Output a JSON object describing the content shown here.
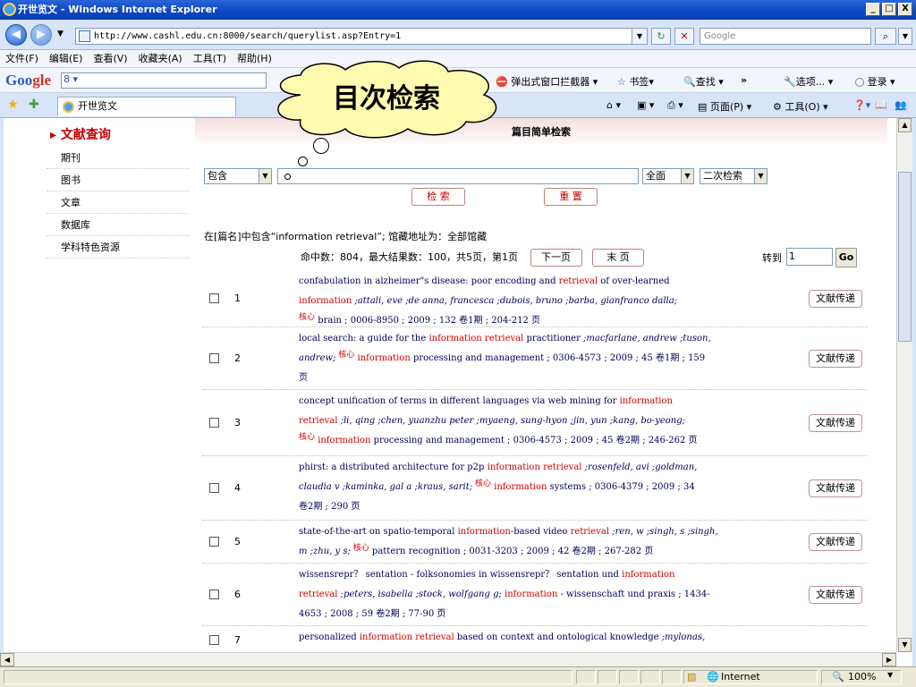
{
  "window": {
    "title": "开世览文 - Windows Internet Explorer"
  },
  "address": {
    "url": "http://www.cashl.edu.cn:8000/search/querylist.asp?Entry=1",
    "search_placeholder": "Google"
  },
  "menu": [
    "文件(F)",
    "编辑(E)",
    "查看(V)",
    "收藏夹(A)",
    "工具(T)",
    "帮助(H)"
  ],
  "gtoolbar": {
    "logo_g": "Goo",
    "logo_o": "gle",
    "popup_blocker": "弹出式窗口拦截器",
    "bookmarks": "书签",
    "find": "查找",
    "more": "»",
    "options": "选项...",
    "login": "登录"
  },
  "tab": {
    "label": "开世览文",
    "page_menu": "页面(P)",
    "tools_menu": "工具(O)"
  },
  "callout": {
    "text": "目次检索"
  },
  "sidebar": {
    "head": "文献查询",
    "items": [
      "期刊",
      "图书",
      "文章",
      "数据库",
      "学科特色资源"
    ]
  },
  "page": {
    "header": "篇目简单检索"
  },
  "form": {
    "match_mode": "包含",
    "query": "",
    "scope": "全面",
    "secondary": "二次检索",
    "search_btn": "检 索",
    "reset_btn": "重 置"
  },
  "meta": {
    "line1": "在[篇名]中包含“information retrieval”;  馆藏地址为：全部馆藏",
    "line2": "命中数：804，最大结果数：100，共5页，第1页",
    "next": "下一页",
    "last": "末 页",
    "goto_label": "转到",
    "goto_value": "1",
    "go": "Go"
  },
  "results": [
    {
      "num": "1",
      "lines": [
        [
          {
            "t": "confabulation in alzheimer\"s disease: poor encoding and "
          },
          {
            "t": "retrieval",
            "c": "r"
          },
          {
            "t": " of over-learned"
          }
        ],
        [
          {
            "t": "information",
            "c": "r"
          },
          {
            "t": " ;attali, eve ;de anna, francesca ;dubois, bruno ;barba, gianfranco dalla;",
            "c": "a"
          }
        ],
        [
          {
            "t": "核心",
            "c": "core"
          },
          {
            "t": "  brain ; 0006-8950 ; 2009 ; 132 "
          },
          {
            "t": "卷1期",
            "c": "vol"
          },
          {
            "t": "  ; 204-212 页"
          }
        ]
      ],
      "delivery": "文献传递"
    },
    {
      "num": "2",
      "lines": [
        [
          {
            "t": "local search: a guide for the "
          },
          {
            "t": "information retrieval",
            "c": "r"
          },
          {
            "t": " practitioner "
          },
          {
            "t": ";macfarlane, andrew ;tuson,",
            "c": "a"
          }
        ],
        [
          {
            "t": "andrew;",
            "c": "a"
          },
          {
            "t": "  核心",
            "c": "core"
          },
          {
            "t": "  "
          },
          {
            "t": "information",
            "c": "r"
          },
          {
            "t": " processing and management ; 0306-4573 ; 2009 ; 45 "
          },
          {
            "t": "卷1期",
            "c": "vol"
          },
          {
            "t": "  ; 159"
          }
        ],
        [
          {
            "t": "页"
          }
        ]
      ],
      "delivery": "文献传递"
    },
    {
      "num": "3",
      "lines": [
        [
          {
            "t": "concept unification of terms in different languages via web mining for "
          },
          {
            "t": "information",
            "c": "r"
          }
        ],
        [
          {
            "t": "retrieval",
            "c": "r"
          },
          {
            "t": " ;li, qing ;chen, yuanzhu peter ;myaeng, sung-hyon ;jin, yun ;kang, bo-yeong;",
            "c": "a"
          }
        ],
        [
          {
            "t": "核心",
            "c": "core"
          },
          {
            "t": "  "
          },
          {
            "t": "information",
            "c": "r"
          },
          {
            "t": " processing and management ; 0306-4573 ; 2009 ; 45 "
          },
          {
            "t": "卷2期",
            "c": "vol"
          },
          {
            "t": "  ; 246-262 页"
          }
        ]
      ],
      "delivery": "文献传递"
    },
    {
      "num": "4",
      "lines": [
        [
          {
            "t": "phirst: a distributed architecture for p2p "
          },
          {
            "t": "information retrieval",
            "c": "r"
          },
          {
            "t": " ;rosenfeld, avi ;goldman,",
            "c": "a"
          }
        ],
        [
          {
            "t": "claudia v ;kaminka, gal a ;kraus, sarit;",
            "c": "a"
          },
          {
            "t": "  核心",
            "c": "core"
          },
          {
            "t": "  "
          },
          {
            "t": "information",
            "c": "r"
          },
          {
            "t": " systems ; 0306-4379 ; 2009 ; 34"
          }
        ],
        [
          {
            "t": "卷2期",
            "c": "vol"
          },
          {
            "t": "  ; 290 页"
          }
        ]
      ],
      "delivery": "文献传递"
    },
    {
      "num": "5",
      "lines": [
        [
          {
            "t": "state-of-the-art on spatio-temporal "
          },
          {
            "t": "information",
            "c": "r"
          },
          {
            "t": "-based video "
          },
          {
            "t": "retrieval",
            "c": "r"
          },
          {
            "t": " ;ren, w ;singh, s ;singh,",
            "c": "a"
          }
        ],
        [
          {
            "t": "m ;zhu, y s;",
            "c": "a"
          },
          {
            "t": "  核心",
            "c": "core"
          },
          {
            "t": "  pattern recognition ; 0031-3203 ; 2009 ; 42 "
          },
          {
            "t": "卷2期",
            "c": "vol"
          },
          {
            "t": "  ; 267-282 页"
          }
        ]
      ],
      "delivery": "文献传递"
    },
    {
      "num": "6",
      "lines": [
        [
          {
            "t": "wissensrepr？ sentation - folksonomies in wissensrepr？ sentation und "
          },
          {
            "t": "information",
            "c": "r"
          }
        ],
        [
          {
            "t": "retrieval",
            "c": "r"
          },
          {
            "t": " ;peters, isabella ;stock, wolfgang g;",
            "c": "a"
          },
          {
            "t": " "
          },
          {
            "t": "information",
            "c": "r"
          },
          {
            "t": " - wissenschaft und praxis ; 1434-"
          }
        ],
        [
          {
            "t": "4653 ; 2008 ; 59 "
          },
          {
            "t": "卷2期",
            "c": "vol"
          },
          {
            "t": "  ; 77-90 页"
          }
        ]
      ],
      "delivery": "文献传递"
    },
    {
      "num": "7",
      "lines": [
        [
          {
            "t": "personalized "
          },
          {
            "t": "information retrieval",
            "c": "r"
          },
          {
            "t": " based on context and ontological knowledge "
          },
          {
            "t": ";mylonas,",
            "c": "a"
          }
        ]
      ],
      "delivery": ""
    }
  ],
  "status": {
    "zone": "Internet",
    "zoom": "100%"
  }
}
